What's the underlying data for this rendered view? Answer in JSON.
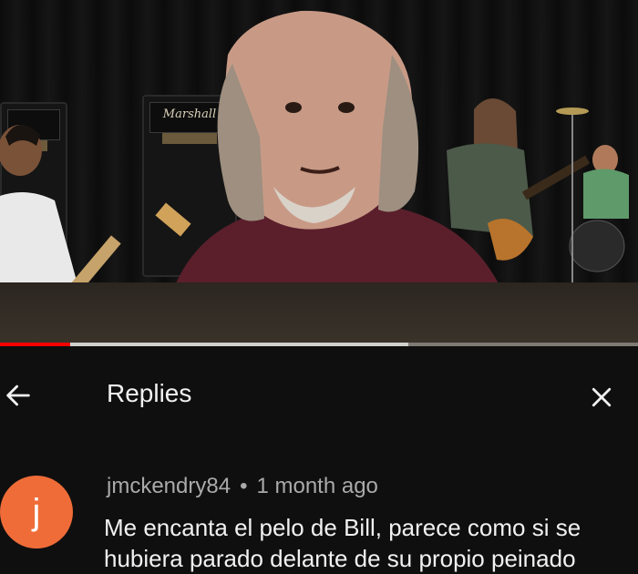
{
  "video": {
    "progress_played_pct": 11,
    "progress_buffered_pct": 64,
    "amp_brand": "Marshall"
  },
  "header": {
    "title": "Replies",
    "back_icon": "arrow-left-icon",
    "close_icon": "close-icon"
  },
  "comment": {
    "avatar_letter": "j",
    "avatar_color": "#ef6c38",
    "author": "jmckendry84",
    "separator": "•",
    "time": "1 month ago",
    "text": "Me encanta el pelo de Bill, parece como si se hubiera parado delante de su propio peinado"
  }
}
